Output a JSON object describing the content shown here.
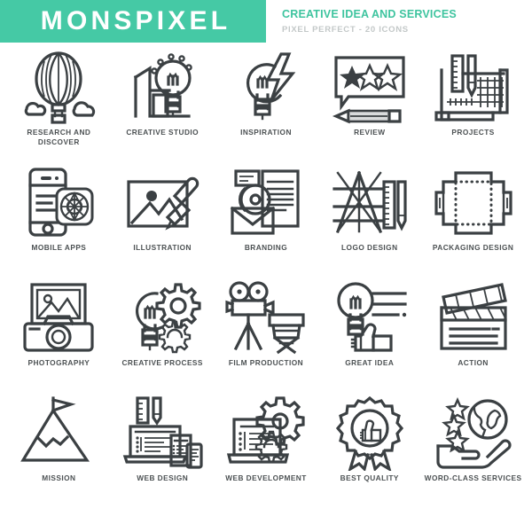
{
  "header": {
    "brand": "MONSPIXEL",
    "tagline": "CREATIVE IDEA AND SERVICES",
    "subtitle": "PIXEL PERFECT - 20 ICONS",
    "brand_bg_color": "#45c9a5",
    "brand_text_color": "#ffffff",
    "tagline_color": "#3ec49f",
    "subtitle_color": "#c3c8c8"
  },
  "style": {
    "icon_stroke_color": "#3b4043",
    "label_color": "#4c5153",
    "background": "#ffffff"
  },
  "icons": [
    {
      "id": "research-and-discover",
      "label": "RESEARCH AND DISCOVER",
      "glyph": "hot-air-balloon-icon",
      "row": 1,
      "col": 1
    },
    {
      "id": "creative-studio",
      "label": "CREATIVE STUDIO",
      "glyph": "studio-building-lightbulb-icon",
      "row": 1,
      "col": 2
    },
    {
      "id": "inspiration",
      "label": "INSPIRATION",
      "glyph": "lightbulb-lightning-bolt-icon",
      "row": 1,
      "col": 3
    },
    {
      "id": "review",
      "label": "REVIEW",
      "glyph": "speech-bubble-stars-pencil-icon",
      "row": 1,
      "col": 4
    },
    {
      "id": "projects",
      "label": "PROJECTS",
      "glyph": "blueprint-ruler-pencil-icon",
      "row": 1,
      "col": 5
    },
    {
      "id": "mobile-apps",
      "label": "MOBILE APPS",
      "glyph": "smartphone-compass-icon",
      "row": 2,
      "col": 1
    },
    {
      "id": "illustration",
      "label": "ILLUSTRATION",
      "glyph": "picture-paintbrush-icon",
      "row": 2,
      "col": 2
    },
    {
      "id": "branding",
      "label": "BRANDING",
      "glyph": "document-cd-envelope-icon",
      "row": 2,
      "col": 3
    },
    {
      "id": "logo-design",
      "label": "LOGO DESIGN",
      "glyph": "letter-a-grid-ruler-pencil-icon",
      "row": 2,
      "col": 4
    },
    {
      "id": "packaging-design",
      "label": "PACKAGING DESIGN",
      "glyph": "unfolded-box-dieline-icon",
      "row": 2,
      "col": 5
    },
    {
      "id": "photography",
      "label": "PHOTOGRAPHY",
      "glyph": "camera-photo-frame-icon",
      "row": 3,
      "col": 1
    },
    {
      "id": "creative-process",
      "label": "CREATIVE PROCESS",
      "glyph": "lightbulb-gears-icon",
      "row": 3,
      "col": 2
    },
    {
      "id": "film-production",
      "label": "FILM PRODUCTION",
      "glyph": "movie-camera-director-chair-icon",
      "row": 3,
      "col": 3
    },
    {
      "id": "great-idea",
      "label": "GREAT IDEA",
      "glyph": "lightbulb-thumbs-up-icon",
      "row": 3,
      "col": 4
    },
    {
      "id": "action",
      "label": "ACTION",
      "glyph": "clapperboard-icon",
      "row": 3,
      "col": 5
    },
    {
      "id": "mission",
      "label": "MISSION",
      "glyph": "mountain-flag-icon",
      "row": 4,
      "col": 1
    },
    {
      "id": "web-design",
      "label": "WEB DESIGN",
      "glyph": "responsive-devices-ruler-pencil-icon",
      "row": 4,
      "col": 2
    },
    {
      "id": "web-development",
      "label": "WEB DEVELOPMENT",
      "glyph": "laptop-gears-icon",
      "row": 4,
      "col": 3
    },
    {
      "id": "best-quality",
      "label": "BEST QUALITY",
      "glyph": "award-ribbon-thumbs-up-icon",
      "row": 4,
      "col": 4
    },
    {
      "id": "word-class-services",
      "label": "WORD-CLASS SERVICES",
      "glyph": "hand-globe-stars-icon",
      "row": 4,
      "col": 5
    }
  ]
}
